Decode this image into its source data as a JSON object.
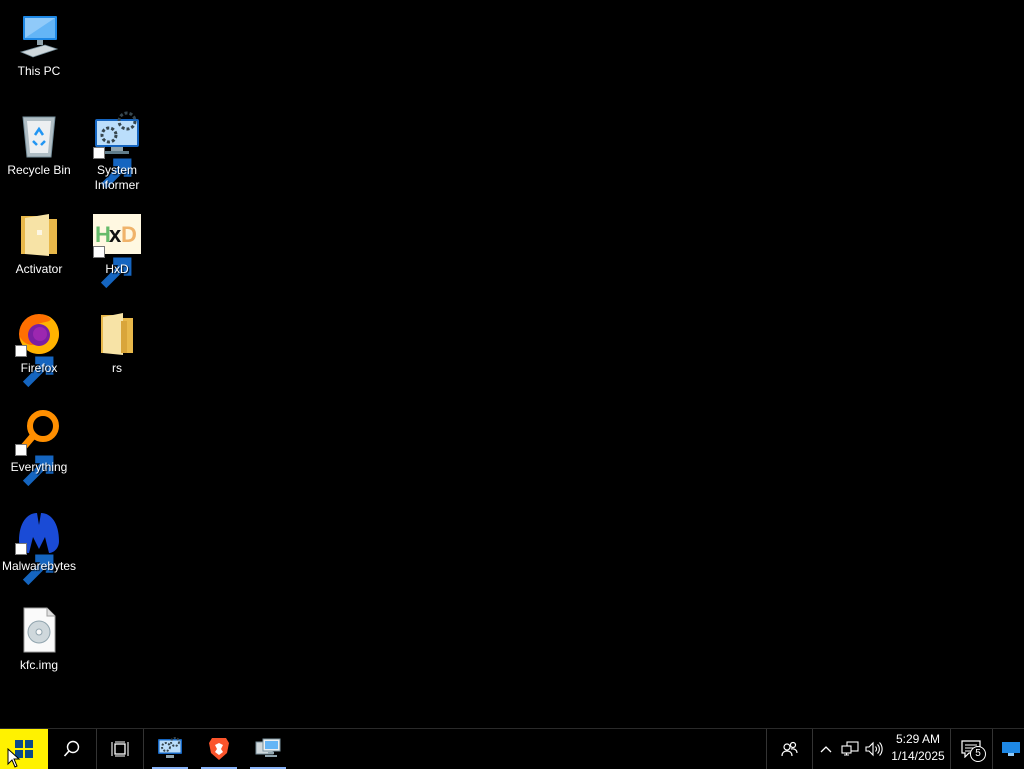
{
  "desktop_icons": {
    "this_pc": "This PC",
    "recycle_bin": "Recycle Bin",
    "activator": "Activator",
    "firefox": "Firefox",
    "everything": "Everything",
    "malwarebytes": "Malwarebytes",
    "kfc_img": "kfc.img",
    "system_informer": "System Informer",
    "hxd": "HxD",
    "rs": "rs"
  },
  "taskbar": {
    "pinned_apps": [
      "System Informer",
      "Brave",
      "Remote Desktop"
    ],
    "clock_time": "5:29 AM",
    "clock_date": "1/14/2025",
    "notification_count": "5"
  },
  "colors": {
    "desktop_background": "#000000",
    "start_highlight": "#fff200",
    "active_underline": "#8ab4f8"
  }
}
